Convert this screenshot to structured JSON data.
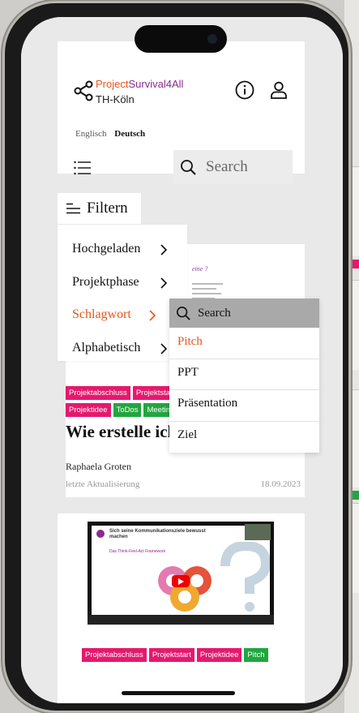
{
  "header": {
    "brand_part1": "Project",
    "brand_part2": "Survival",
    "brand_part3": "4All",
    "institution": "TH-Köln",
    "languages": [
      "Englisch",
      "Deutsch"
    ],
    "active_language": "Deutsch",
    "search_placeholder": "Search"
  },
  "filter": {
    "label": "Filtern",
    "items": [
      {
        "label": "Hochgeladen"
      },
      {
        "label": "Projektphase"
      },
      {
        "label": "Schlagwort"
      },
      {
        "label": "Alphabetisch"
      }
    ],
    "active_item": "Schlagwort"
  },
  "keyword_menu": {
    "search_placeholder": "Search",
    "items": [
      "Pitch",
      "PPT",
      "Präsentation",
      "Ziel"
    ],
    "active_item": "Pitch"
  },
  "card1": {
    "tags_row1": [
      "Projektabschluss",
      "Projektstart"
    ],
    "tags_row2": [
      "Projektidee",
      "ToDos",
      "Meeting"
    ],
    "title": "Wie erstelle ich eine Agenda?",
    "author": "Raphaela Groten",
    "updated_label": "letzte Aktualisierung",
    "date": "18.09.2023",
    "thumb_text": "eine ?"
  },
  "card2": {
    "video_heading": "Sich seine Kommunikationsziele bewusst machen",
    "video_sub": "Das Think-Feel-Act Framework",
    "tags": [
      {
        "label": "Projektabschluss",
        "color": "pink"
      },
      {
        "label": "Projektstart",
        "color": "pink"
      },
      {
        "label": "Projektidee",
        "color": "pink"
      },
      {
        "label": "Pitch",
        "color": "green"
      }
    ]
  },
  "colors": {
    "accent_orange": "#e8561a",
    "brand_purple": "#8a2a8f",
    "tag_pink": "#e4196e",
    "tag_green": "#21a63f"
  }
}
